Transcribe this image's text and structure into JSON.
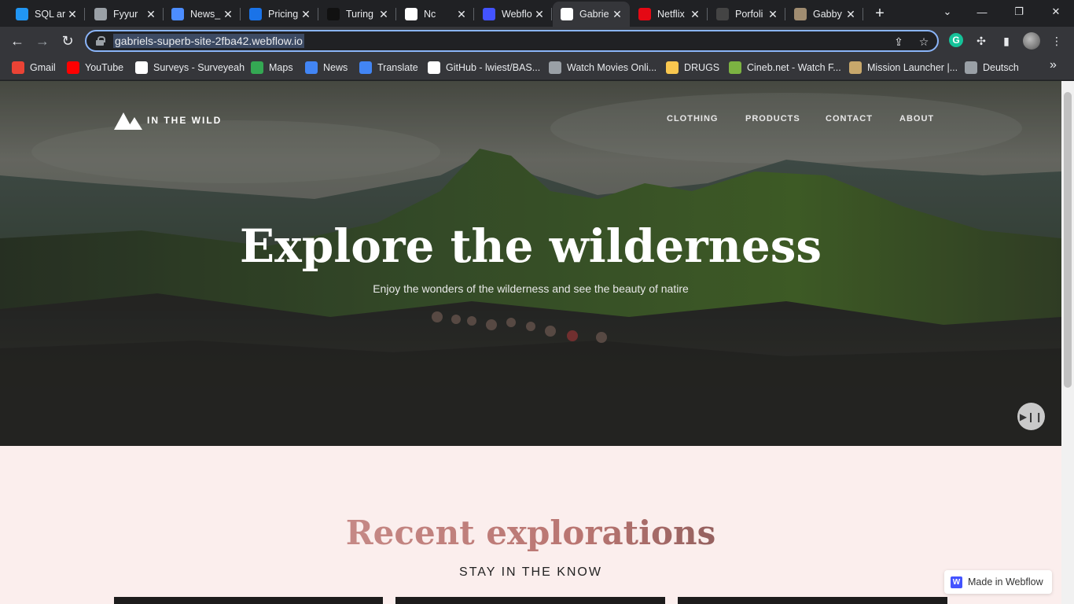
{
  "browser": {
    "tabs": [
      {
        "label": "SQL ar",
        "icon": "u-logo-icon",
        "color": "#2196f3"
      },
      {
        "label": "Fyyur",
        "icon": "globe-icon",
        "color": "#9aa0a6"
      },
      {
        "label": "News_",
        "icon": "triangle-logo-icon",
        "color": "#4c8dff"
      },
      {
        "label": "Pricing",
        "icon": "pricing-icon",
        "color": "#1a73e8"
      },
      {
        "label": "Turing",
        "icon": "turing-logo-icon",
        "color": "#111111"
      },
      {
        "label": "Nc",
        "icon": "c-logo-icon",
        "color": "#ffffff"
      },
      {
        "label": "Webflo",
        "icon": "webflow-icon",
        "color": "#4353ff"
      },
      {
        "label": "Gabrie",
        "icon": "webflow-w-icon",
        "color": "#ffffff",
        "active": true
      },
      {
        "label": "Netflix",
        "icon": "netflix-icon",
        "color": "#e50914"
      },
      {
        "label": "Porfoli",
        "icon": "s-logo-icon",
        "color": "#444444"
      },
      {
        "label": "Gabby",
        "icon": "photo-icon",
        "color": "#a08c70"
      }
    ],
    "omnibox": {
      "url": "gabriels-superb-site-2fba42.webflow.io"
    },
    "bookmarks": [
      {
        "label": "Gmail",
        "icon": "gmail-icon",
        "color": "#ea4335"
      },
      {
        "label": "YouTube",
        "icon": "youtube-icon",
        "color": "#ff0000"
      },
      {
        "label": "Surveys - Surveyeah",
        "icon": "surveyeah-icon",
        "color": "#ffffff"
      },
      {
        "label": "Maps",
        "icon": "maps-icon",
        "color": "#34a853"
      },
      {
        "label": "News",
        "icon": "news-icon",
        "color": "#4285f4"
      },
      {
        "label": "Translate",
        "icon": "translate-icon",
        "color": "#4285f4"
      },
      {
        "label": "GitHub - lwiest/BAS...",
        "icon": "github-icon",
        "color": "#ffffff"
      },
      {
        "label": "Watch Movies Onli...",
        "icon": "globe-icon",
        "color": "#9aa0a6"
      },
      {
        "label": "DRUGS",
        "icon": "emoji-icon",
        "color": "#f9c74f"
      },
      {
        "label": "Cineb.net - Watch F...",
        "icon": "play-circle-icon",
        "color": "#7cb342"
      },
      {
        "label": "Mission Launcher |...",
        "icon": "mission-icon",
        "color": "#c8a86b"
      },
      {
        "label": "Deutsch",
        "icon": "globe-icon",
        "color": "#9aa0a6"
      }
    ]
  },
  "site": {
    "logo_text": "IN THE WILD",
    "nav": [
      "CLOTHING",
      "PRODUCTS",
      "CONTACT",
      "ABOUT"
    ],
    "hero_title": "Explore the wilderness",
    "hero_subtitle": "Enjoy the wonders of the wilderness and see the beauty of natire",
    "recent_title": "Recent explorations",
    "recent_subtitle": "STAY IN THE KNOW",
    "badge_text": "Made in Webflow"
  }
}
